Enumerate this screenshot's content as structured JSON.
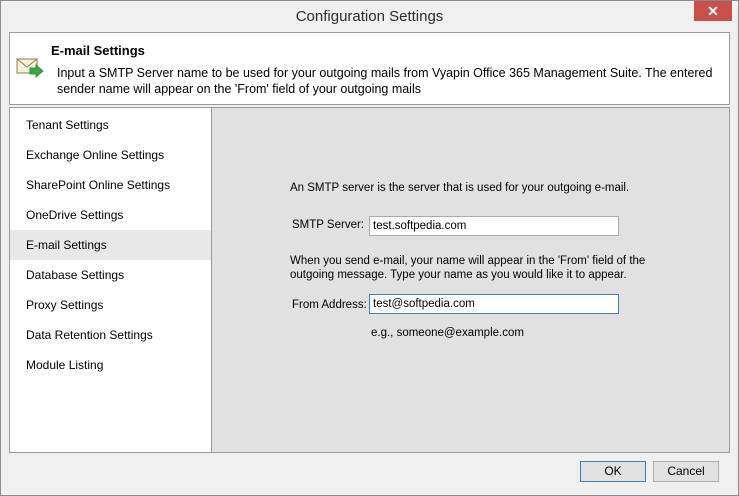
{
  "window": {
    "title": "Configuration Settings",
    "close_glyph": "✕"
  },
  "header": {
    "icon": "email-settings-icon",
    "title": "E-mail Settings",
    "description": "Input a SMTP Server name to be used for your outgoing mails from Vyapin Office 365 Management Suite. The entered sender name will appear on the 'From' field of your outgoing mails"
  },
  "sidebar": {
    "items": [
      {
        "label": "Tenant Settings"
      },
      {
        "label": "Exchange Online Settings"
      },
      {
        "label": "SharePoint Online Settings"
      },
      {
        "label": "OneDrive Settings"
      },
      {
        "label": "E-mail Settings",
        "selected": true
      },
      {
        "label": "Database Settings"
      },
      {
        "label": "Proxy Settings"
      },
      {
        "label": "Data Retention Settings"
      },
      {
        "label": "Module Listing"
      }
    ]
  },
  "main": {
    "intro": "An SMTP server is the server that is used for your outgoing e-mail.",
    "smtp_label": "SMTP Server:",
    "smtp_value": "test.softpedia.com",
    "note": "When you send e-mail, your name will appear in the 'From' field of the outgoing message. Type your name as you would like it to appear.",
    "from_label": "From Address:",
    "from_value": "test@softpedia.com",
    "example": "e.g., someone@example.com"
  },
  "footer": {
    "ok_label": "OK",
    "cancel_label": "Cancel"
  }
}
